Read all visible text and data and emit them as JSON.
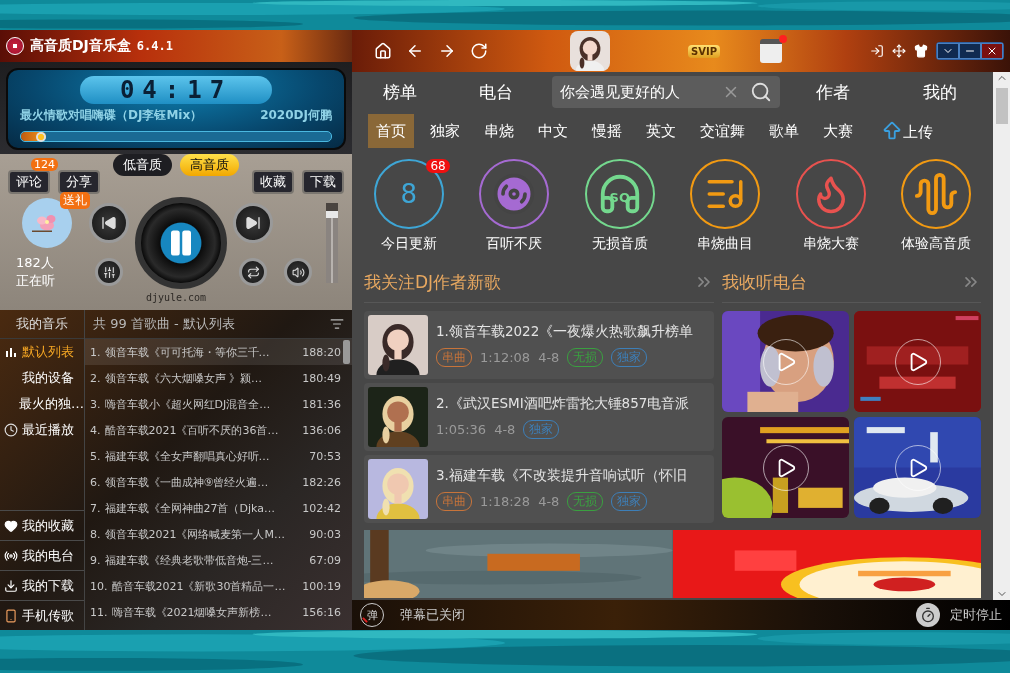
{
  "app": {
    "title": "高音质DJ音乐盒",
    "version": "6.4.1"
  },
  "player": {
    "time": "04:17",
    "track": "最火情歌对唱嗨碟（DJ李钰Mix）",
    "artist": "2020DJ何鹏",
    "progress": {
      "level": 0.08
    },
    "quality": [
      {
        "label": "低音质",
        "selected": false
      },
      {
        "label": "高音质",
        "selected": true
      }
    ],
    "actions": [
      {
        "label": "评论",
        "badge": "124"
      },
      {
        "label": "分享"
      },
      {
        "label": "收藏"
      },
      {
        "label": "下载"
      }
    ],
    "gift": "送礼",
    "listeners": "182人",
    "listening": "正在听",
    "volume": {
      "level": 0.9
    },
    "watermark": "djyule.com"
  },
  "sidebar": {
    "title": "我的音乐",
    "items": [
      {
        "label": "默认列表",
        "selected": true
      },
      {
        "label": "我的设备",
        "selected": false
      },
      {
        "label": "最火的独…",
        "selected": false
      },
      {
        "label": "最近播放",
        "selected": false
      }
    ],
    "links": [
      {
        "label": "我的收藏"
      },
      {
        "label": "我的电台"
      },
      {
        "label": "我的下载"
      },
      {
        "label": "手机传歌"
      }
    ]
  },
  "playlist": {
    "summary": "共 99 首歌曲 - 默认列表",
    "songs": [
      {
        "index": "1.",
        "title": "领音车载《可可托海・等你三千…",
        "duration": "188:20",
        "selected": true
      },
      {
        "index": "2.",
        "title": "领音车载《六大烟嗓女声 》颍…",
        "duration": "180:49",
        "selected": false
      },
      {
        "index": "3.",
        "title": "嗨音车载小《超火网红DJ混音全…",
        "duration": "181:36",
        "selected": false
      },
      {
        "index": "4.",
        "title": "酷音车载2021《百听不厌的36首…",
        "duration": "136:06",
        "selected": false
      },
      {
        "index": "5.",
        "title": "福建车载《全女声翻唱真心好听…",
        "duration": "70:53",
        "selected": false
      },
      {
        "index": "6.",
        "title": "领音车载《一曲成神⑨曾经火遍…",
        "duration": "182:26",
        "selected": false
      },
      {
        "index": "7.",
        "title": "福建车载《全网神曲27首（Djka…",
        "duration": "102:42",
        "selected": false
      },
      {
        "index": "8.",
        "title": "领音车载2021《网络喊麦第一人M…",
        "duration": "90:03",
        "selected": false
      },
      {
        "index": "9.",
        "title": "福建车载《经典老歌带低音炮-三…",
        "duration": "67:09",
        "selected": false
      },
      {
        "index": "10.",
        "title": "酷音车载2021《新歌30首精品一…",
        "duration": "100:19",
        "selected": false
      },
      {
        "index": "11.",
        "title": "嗨音车载《2021烟嗓女声新榜…",
        "duration": "156:16",
        "selected": false
      }
    ]
  },
  "topbar": {
    "badge": "SVIP",
    "unread": true
  },
  "nav": {
    "tabs_left": [
      "榜单",
      "电台"
    ],
    "search": {
      "value": "你会遇见更好的人"
    },
    "tabs_right": [
      "作者",
      "我的"
    ]
  },
  "categories": [
    {
      "label": "首页",
      "selected": true
    },
    {
      "label": "独家",
      "selected": false
    },
    {
      "label": "串烧",
      "selected": false
    },
    {
      "label": "中文",
      "selected": false
    },
    {
      "label": "慢摇",
      "selected": false
    },
    {
      "label": "英文",
      "selected": false
    },
    {
      "label": "交谊舞",
      "selected": false
    },
    {
      "label": "歌单",
      "selected": false
    },
    {
      "label": "大赛",
      "selected": false
    }
  ],
  "upload": "上传",
  "features": [
    {
      "label": "今日更新",
      "kind": "count",
      "value": "8",
      "badge": "68",
      "color": "#3ea6d6"
    },
    {
      "label": "百听不厌",
      "kind": "disc",
      "color": "#a56ad2"
    },
    {
      "label": "无损音质",
      "kind": "headphones",
      "value": "SQ",
      "color": "#74d88e"
    },
    {
      "label": "串烧曲目",
      "kind": "playlist",
      "color": "#f29a12"
    },
    {
      "label": "串烧大赛",
      "kind": "flame",
      "color": "#e8524f"
    },
    {
      "label": "体验高音质",
      "kind": "waveform",
      "color": "#f29a12"
    }
  ],
  "followed": {
    "title": "我关注DJ作者新歌",
    "songs": [
      {
        "title": "1.领音车载2022《一夜爆火热歌飙升榜单",
        "meta": [
          {
            "kind": "tag",
            "label": "串曲",
            "color": "#c8743a"
          },
          {
            "kind": "text",
            "label": "1:12:08"
          },
          {
            "kind": "text",
            "label": "4-8"
          },
          {
            "kind": "tag",
            "label": "无损",
            "color": "#3aa040"
          },
          {
            "kind": "tag",
            "label": "独家",
            "color": "#3d7fb8"
          }
        ]
      },
      {
        "title": "2.《武汉ESMI酒吧炸雷抡大锤857电音派",
        "meta": [
          {
            "kind": "text",
            "label": "1:05:36"
          },
          {
            "kind": "text",
            "label": "4-8"
          },
          {
            "kind": "tag",
            "label": "独家",
            "color": "#3d7fb8"
          }
        ]
      },
      {
        "title": "3.福建车载《不改装提升音响试听（怀旧",
        "meta": [
          {
            "kind": "tag",
            "label": "串曲",
            "color": "#c8743a"
          },
          {
            "kind": "text",
            "label": "1:18:28"
          },
          {
            "kind": "text",
            "label": "4-8"
          },
          {
            "kind": "tag",
            "label": "无损",
            "color": "#3aa040"
          },
          {
            "kind": "tag",
            "label": "独家",
            "color": "#3d7fb8"
          }
        ]
      }
    ]
  },
  "radio": {
    "title": "我收听电台"
  },
  "status": {
    "danmaku_icon": "弹",
    "danmaku": "弹幕已关闭",
    "timer": "定时停止"
  }
}
